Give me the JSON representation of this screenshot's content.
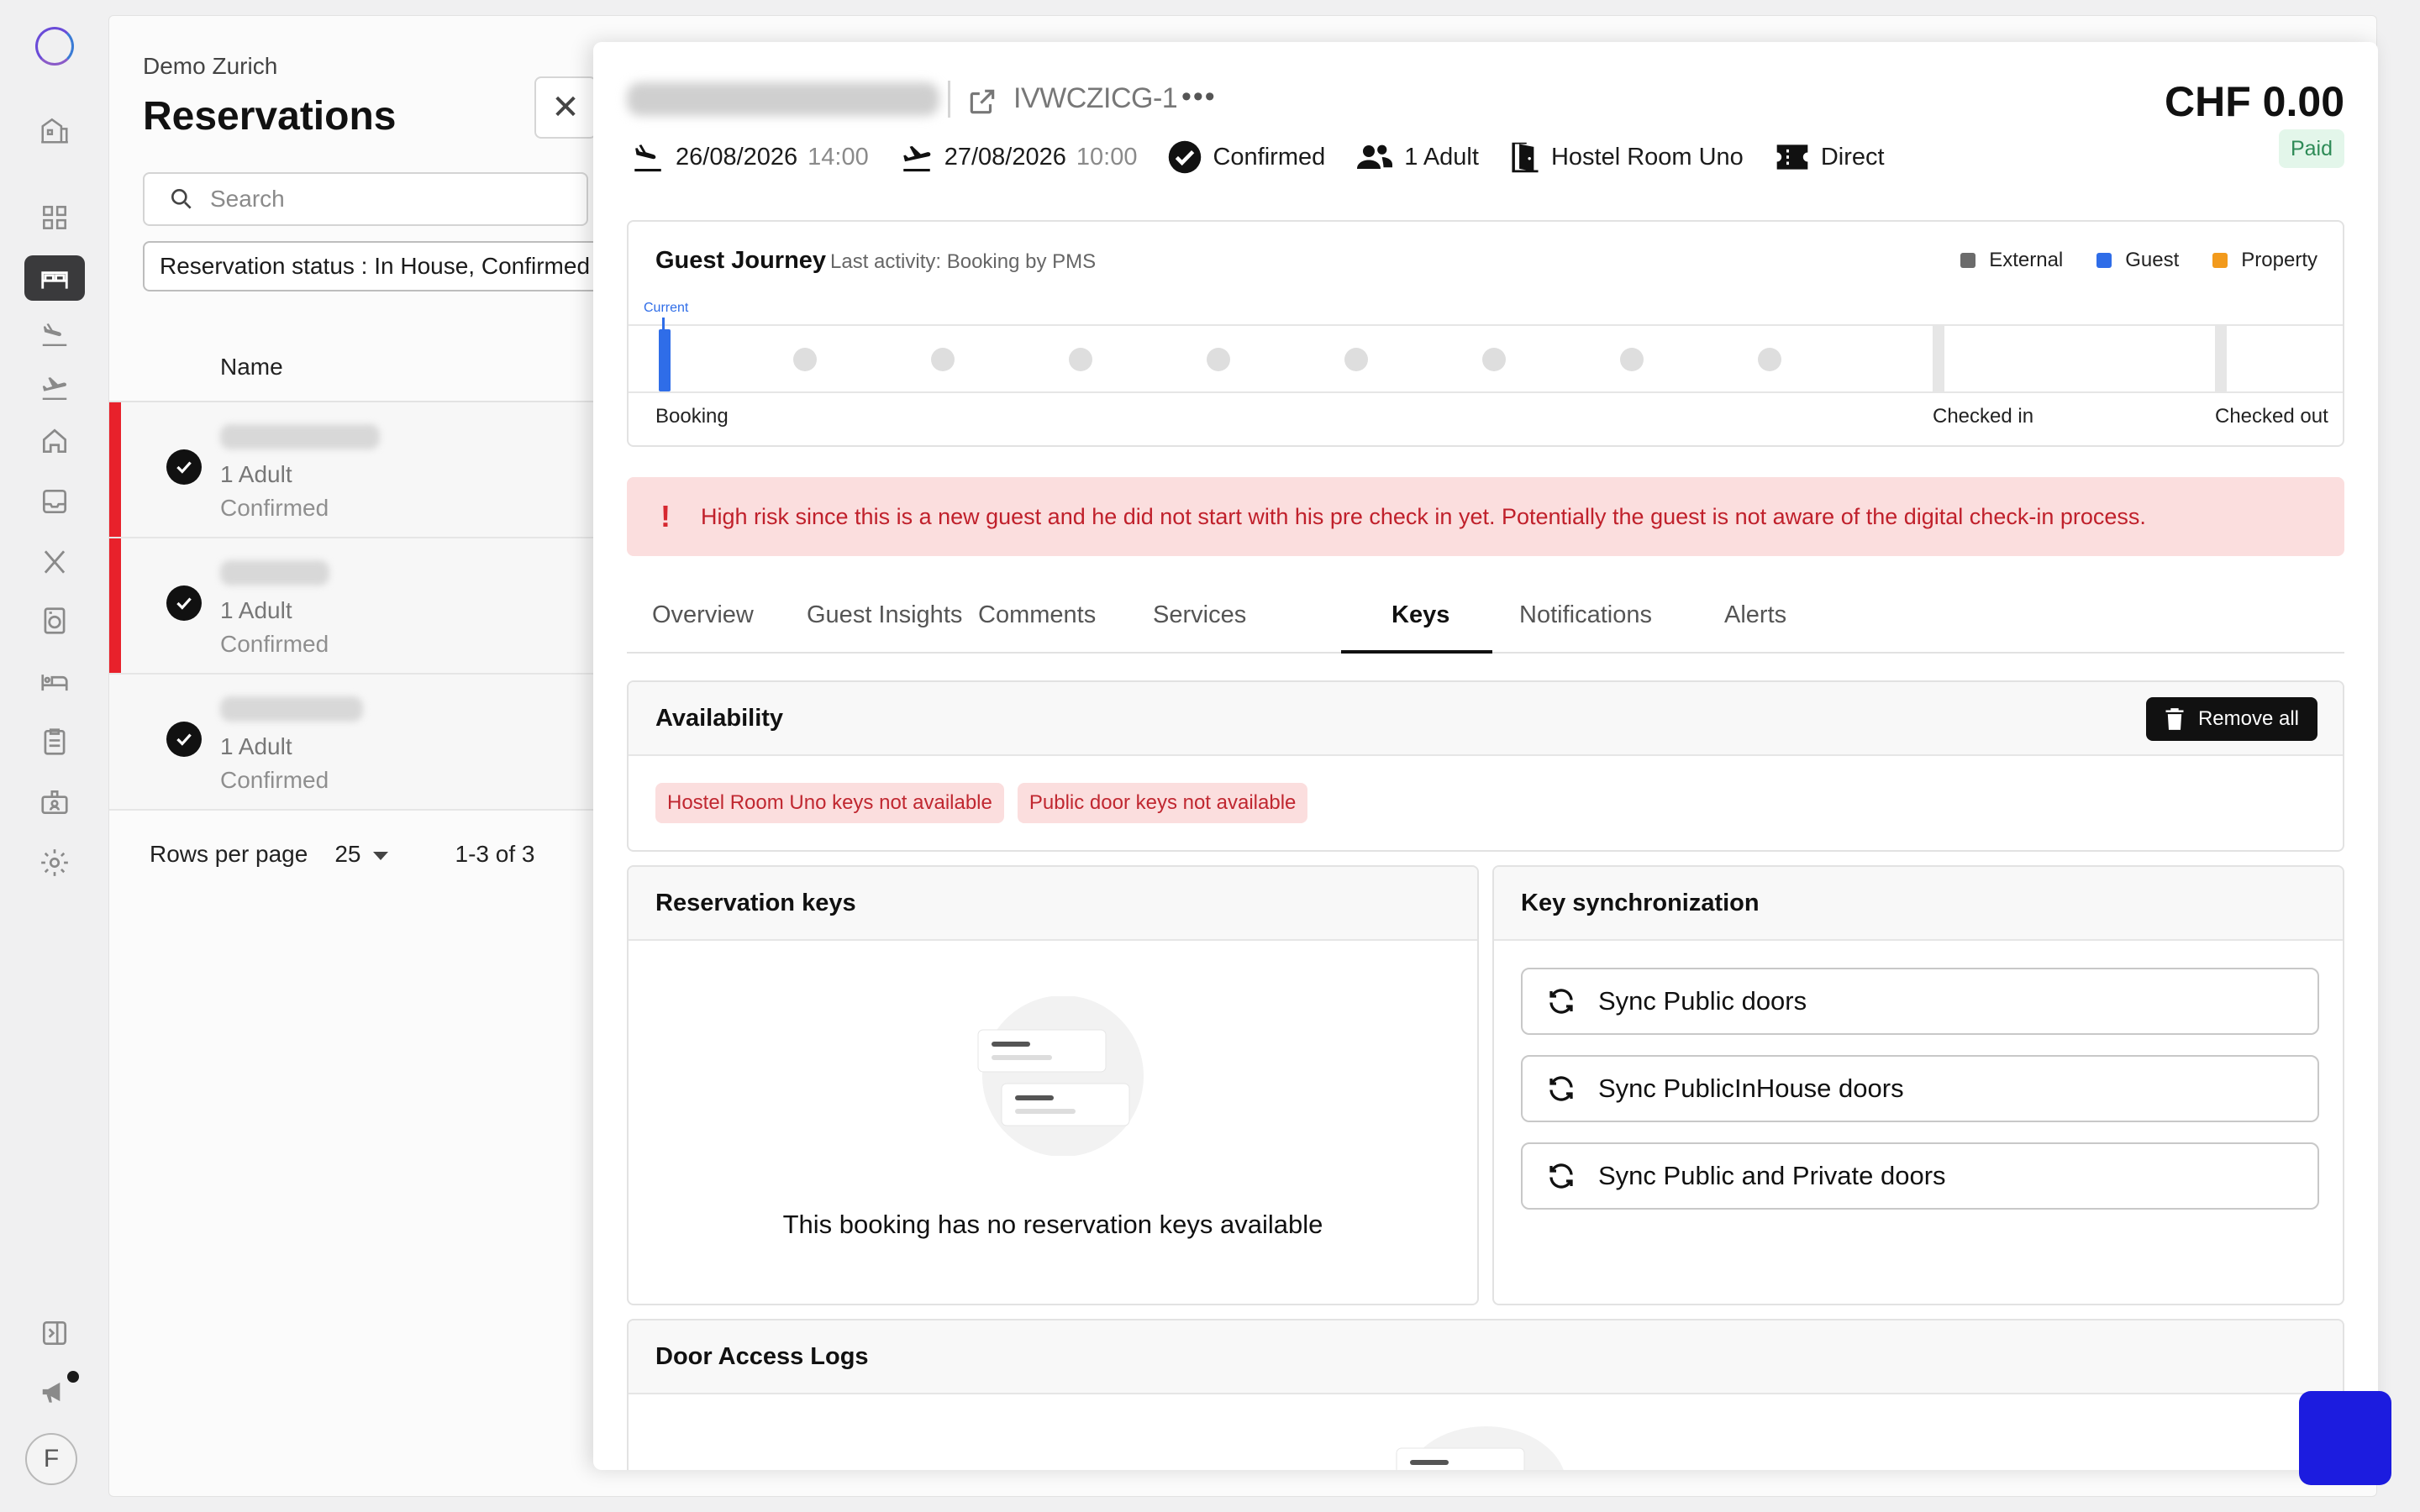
{
  "list": {
    "hotel_name": "Demo Zurich",
    "title": "Reservations",
    "search_placeholder": "Search",
    "filter_text": "Reservation status : In House, Confirmed",
    "column_name": "Name",
    "rows": [
      {
        "adults": "1 Adult",
        "status": "Confirmed",
        "high_risk": true
      },
      {
        "adults": "1 Adult",
        "status": "Confirmed",
        "high_risk": true
      },
      {
        "adults": "1 Adult",
        "status": "Confirmed",
        "high_risk": false
      }
    ],
    "rows_per_page_label": "Rows per page",
    "rows_per_page_value": "25",
    "pagination": "1-3 of 3"
  },
  "detail": {
    "reservation_code": "IVWCZICG-1",
    "more_label": "•••",
    "price": "CHF 0.00",
    "payment_status": "Paid",
    "arrival_date": "26/08/2026",
    "arrival_time": "14:00",
    "departure_date": "27/08/2026",
    "departure_time": "10:00",
    "status": "Confirmed",
    "guests": "1 Adult",
    "room": "Hostel Room Uno",
    "channel": "Direct"
  },
  "journey": {
    "title": "Guest Journey",
    "last_activity": "Last activity: Booking by PMS",
    "current_label": "Current",
    "legend": [
      {
        "label": "External",
        "color": "#6b6b6b"
      },
      {
        "label": "Guest",
        "color": "#2f6de8"
      },
      {
        "label": "Property",
        "color": "#f29a1c"
      }
    ],
    "stages": [
      "Booking",
      "Checked in",
      "Checked out"
    ]
  },
  "alert": {
    "icon": "!",
    "text": "High risk since this is a new guest and he did not start with his pre check in yet. Potentially the guest is not aware of the digital check-in process."
  },
  "tabs": [
    {
      "label": "Overview",
      "active": false
    },
    {
      "label": "Guest Insights",
      "active": false
    },
    {
      "label": "Comments",
      "active": false
    },
    {
      "label": "Services",
      "active": false
    },
    {
      "label": "Keys",
      "active": true
    },
    {
      "label": "Notifications",
      "active": false
    },
    {
      "label": "Alerts",
      "active": false
    }
  ],
  "availability": {
    "title": "Availability",
    "remove_all_label": "Remove all",
    "badges": [
      "Hostel Room Uno keys not available",
      "Public door keys not available"
    ]
  },
  "reservation_keys": {
    "title": "Reservation keys",
    "empty_text": "This booking has no reservation keys available"
  },
  "key_sync": {
    "title": "Key synchronization",
    "buttons": [
      "Sync Public doors",
      "Sync PublicInHouse doors",
      "Sync Public and Private doors"
    ]
  },
  "door_logs": {
    "title": "Door Access Logs"
  },
  "nav": {
    "avatar_initial": "F",
    "icons": [
      "dashboard-icon",
      "reservations-icon",
      "arrivals-icon",
      "departures-icon",
      "house-icon",
      "inbox-icon",
      "restaurant-icon",
      "laundry-icon",
      "rooms-icon",
      "tasks-icon",
      "staff-icon",
      "settings-icon",
      "collapse-icon",
      "announcements-icon"
    ]
  },
  "colors": {
    "accent_blue": "#2f6de8",
    "risk_red": "#e8212b",
    "paid_green": "#2e8b57"
  }
}
